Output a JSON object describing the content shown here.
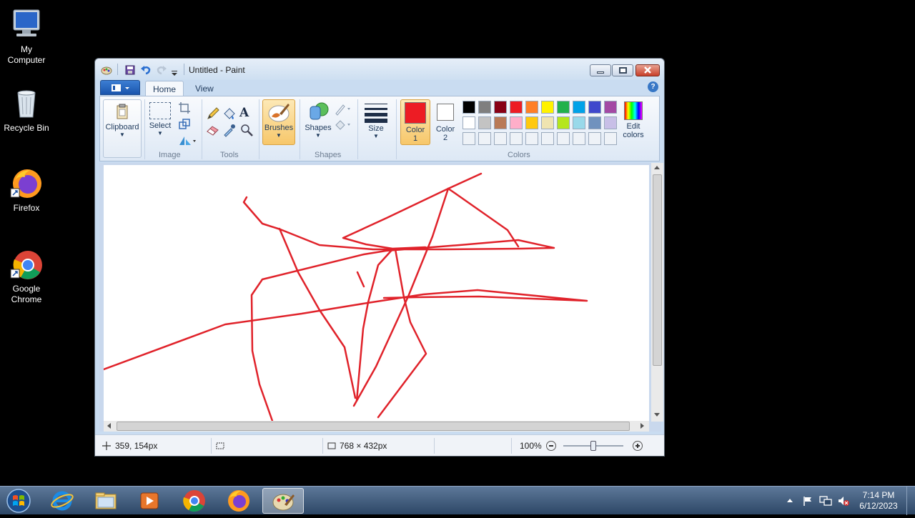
{
  "desktop": {
    "icons": [
      {
        "label": "My\nComputer",
        "icon": "computer-icon"
      },
      {
        "label": "Recycle Bin",
        "icon": "recycle-bin-icon"
      },
      {
        "label": "Firefox",
        "icon": "firefox-icon"
      },
      {
        "label": "Google\nChrome",
        "icon": "chrome-icon"
      }
    ]
  },
  "window": {
    "title": "Untitled - Paint",
    "tabs": {
      "home": "Home",
      "view": "View"
    },
    "help": "?",
    "ribbon": {
      "clipboard": {
        "label": "Clipboard",
        "group": ""
      },
      "image": {
        "select_label": "Select",
        "group": "Image"
      },
      "tools": {
        "group": "Tools",
        "text_tool": "A"
      },
      "brushes": {
        "label": "Brushes"
      },
      "shapes": {
        "label": "Shapes",
        "group": "Shapes"
      },
      "size": {
        "label": "Size"
      },
      "color1": {
        "label": "Color",
        "num": "1",
        "color": "#ed1c24"
      },
      "color2": {
        "label": "Color",
        "num": "2",
        "color": "#ffffff"
      },
      "colors_group": "Colors",
      "edit_colors": {
        "label1": "Edit",
        "label2": "colors"
      },
      "palette_row1": [
        "#000000",
        "#7f7f7f",
        "#880015",
        "#ed1c24",
        "#ff7f27",
        "#fff200",
        "#22b14c",
        "#00a2e8",
        "#3f48cc",
        "#a349a4"
      ],
      "palette_row2": [
        "#ffffff",
        "#c3c3c3",
        "#b97a57",
        "#ffaec9",
        "#ffc90e",
        "#efe4b0",
        "#b5e61d",
        "#99d9ea",
        "#7092be",
        "#c8bfe7"
      ]
    },
    "status": {
      "cursor_pos": "359, 154px",
      "canvas_size": "768 × 432px",
      "zoom": "100%"
    }
  },
  "taskbar": {
    "time": "7:14 PM",
    "date": "6/12/2023",
    "apps": [
      "start-orb",
      "internet-explorer",
      "file-explorer",
      "media-player",
      "chrome",
      "firefox",
      "paint"
    ]
  }
}
